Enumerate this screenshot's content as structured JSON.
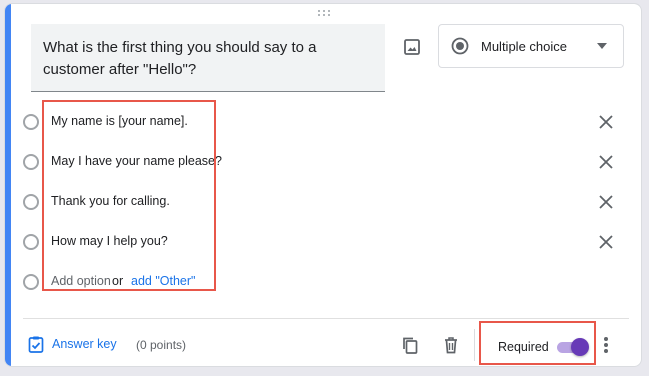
{
  "question": {
    "text": "What is the first thing you should say to a customer after \"Hello\"?",
    "type_label": "Multiple choice"
  },
  "options": [
    {
      "label": "My name is [your name]."
    },
    {
      "label": "May I have your name please?"
    },
    {
      "label": "Thank you for calling."
    },
    {
      "label": "How may I help you?"
    }
  ],
  "add_row": {
    "add_option_label": "Add option",
    "or_label": "or",
    "add_other_label": "add \"Other\""
  },
  "footer": {
    "answer_key_label": "Answer key",
    "points_label": "(0 points)",
    "required_label": "Required",
    "required_on": true
  },
  "colors": {
    "accent": "#4285f4",
    "link": "#1a73e8",
    "toggle": "#673ab7",
    "highlight": "#e8574a"
  },
  "icons": [
    "drag-handle-icon",
    "image-icon",
    "radio-button-icon",
    "dropdown-caret-icon",
    "close-icon",
    "answer-key-icon",
    "duplicate-icon",
    "delete-icon",
    "more-vert-icon"
  ]
}
